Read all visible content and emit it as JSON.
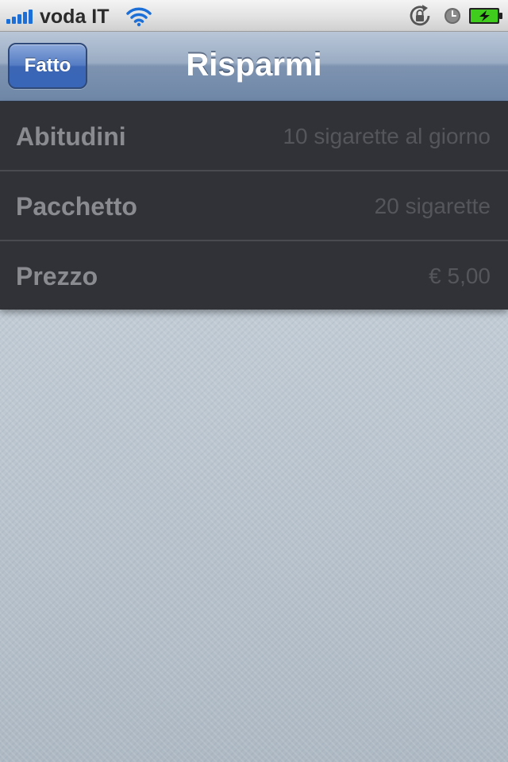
{
  "status_bar": {
    "carrier": "voda IT",
    "signal_icon": "signal-bars-icon",
    "wifi_icon": "wifi-icon",
    "rotation_lock_icon": "rotation-lock-icon",
    "alarm_icon": "alarm-clock-icon",
    "battery_icon": "battery-charging-icon",
    "signal_color": "#1d6fd8",
    "battery_color": "#3fcc1c"
  },
  "nav_bar": {
    "title": "Risparmi",
    "done_label": "Fatto",
    "button_color": "#3a66b8"
  },
  "settings": [
    {
      "label": "Abitudini",
      "value": "10 sigarette al giorno"
    },
    {
      "label": "Pacchetto",
      "value": "20 sigarette"
    },
    {
      "label": "Prezzo",
      "value": "€ 5,00"
    }
  ]
}
